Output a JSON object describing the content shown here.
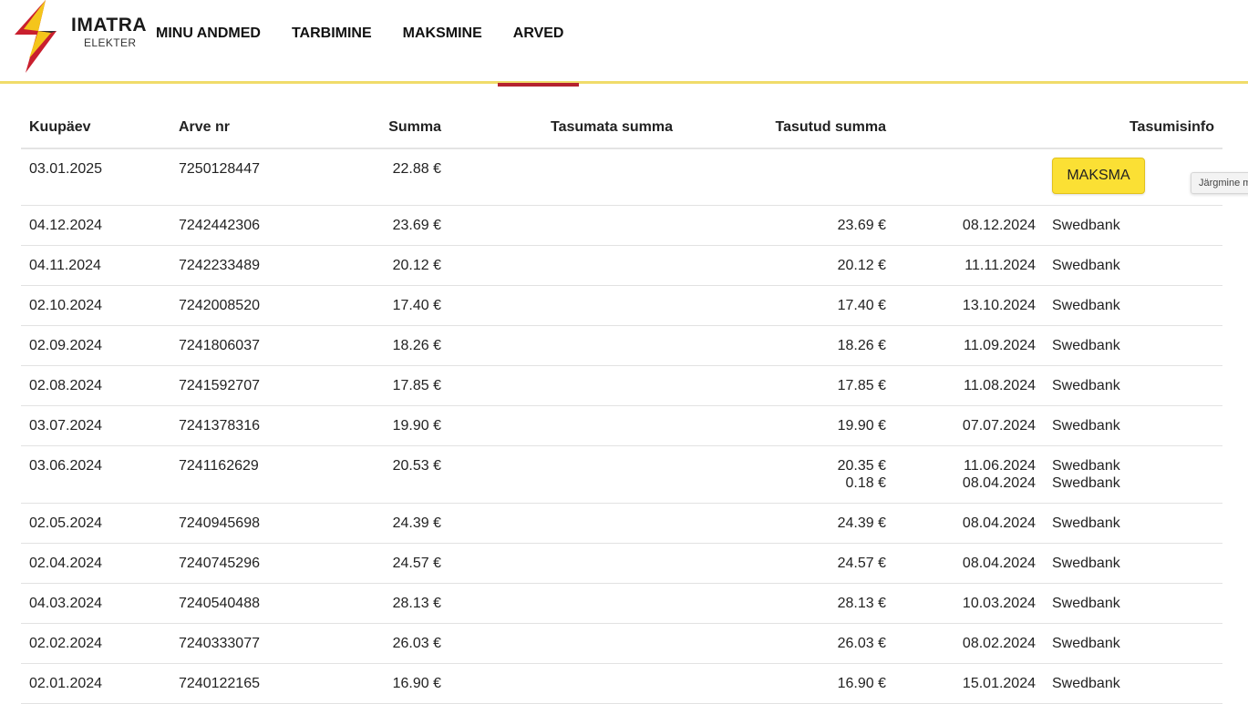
{
  "brand": {
    "name": "IMATRA",
    "sub": "ELEKTER"
  },
  "nav": [
    {
      "label": "MINU ANDMED",
      "active": false
    },
    {
      "label": "TARBIMINE",
      "active": false
    },
    {
      "label": "MAKSMINE",
      "active": false
    },
    {
      "label": "ARVED",
      "active": true
    }
  ],
  "table": {
    "headers": {
      "date": "Kuupäev",
      "invoice": "Arve nr",
      "sum": "Summa",
      "unpaid": "Tasumata summa",
      "paid": "Tasutud summa",
      "info": "Tasumisinfo"
    },
    "pay_button": "MAKSMA",
    "rows": [
      {
        "date": "03.01.2025",
        "invoice": "7250128447",
        "sum": "22.88 €",
        "unpaid": "",
        "payments": [],
        "pay": true
      },
      {
        "date": "04.12.2024",
        "invoice": "7242442306",
        "sum": "23.69 €",
        "unpaid": "",
        "payments": [
          {
            "amount": "23.69 €",
            "date": "08.12.2024",
            "bank": "Swedbank"
          }
        ]
      },
      {
        "date": "04.11.2024",
        "invoice": "7242233489",
        "sum": "20.12 €",
        "unpaid": "",
        "payments": [
          {
            "amount": "20.12 €",
            "date": "11.11.2024",
            "bank": "Swedbank"
          }
        ]
      },
      {
        "date": "02.10.2024",
        "invoice": "7242008520",
        "sum": "17.40 €",
        "unpaid": "",
        "payments": [
          {
            "amount": "17.40 €",
            "date": "13.10.2024",
            "bank": "Swedbank"
          }
        ]
      },
      {
        "date": "02.09.2024",
        "invoice": "7241806037",
        "sum": "18.26 €",
        "unpaid": "",
        "payments": [
          {
            "amount": "18.26 €",
            "date": "11.09.2024",
            "bank": "Swedbank"
          }
        ]
      },
      {
        "date": "02.08.2024",
        "invoice": "7241592707",
        "sum": "17.85 €",
        "unpaid": "",
        "payments": [
          {
            "amount": "17.85 €",
            "date": "11.08.2024",
            "bank": "Swedbank"
          }
        ]
      },
      {
        "date": "03.07.2024",
        "invoice": "7241378316",
        "sum": "19.90 €",
        "unpaid": "",
        "payments": [
          {
            "amount": "19.90 €",
            "date": "07.07.2024",
            "bank": "Swedbank"
          }
        ]
      },
      {
        "date": "03.06.2024",
        "invoice": "7241162629",
        "sum": "20.53 €",
        "unpaid": "",
        "payments": [
          {
            "amount": "20.35 €",
            "date": "11.06.2024",
            "bank": "Swedbank"
          },
          {
            "amount": "0.18 €",
            "date": "08.04.2024",
            "bank": "Swedbank"
          }
        ]
      },
      {
        "date": "02.05.2024",
        "invoice": "7240945698",
        "sum": "24.39 €",
        "unpaid": "",
        "payments": [
          {
            "amount": "24.39 €",
            "date": "08.04.2024",
            "bank": "Swedbank"
          }
        ]
      },
      {
        "date": "02.04.2024",
        "invoice": "7240745296",
        "sum": "24.57 €",
        "unpaid": "",
        "payments": [
          {
            "amount": "24.57 €",
            "date": "08.04.2024",
            "bank": "Swedbank"
          }
        ]
      },
      {
        "date": "04.03.2024",
        "invoice": "7240540488",
        "sum": "28.13 €",
        "unpaid": "",
        "payments": [
          {
            "amount": "28.13 €",
            "date": "10.03.2024",
            "bank": "Swedbank"
          }
        ]
      },
      {
        "date": "02.02.2024",
        "invoice": "7240333077",
        "sum": "26.03 €",
        "unpaid": "",
        "payments": [
          {
            "amount": "26.03 €",
            "date": "08.02.2024",
            "bank": "Swedbank"
          }
        ]
      },
      {
        "date": "02.01.2024",
        "invoice": "7240122165",
        "sum": "16.90 €",
        "unpaid": "",
        "payments": [
          {
            "amount": "16.90 €",
            "date": "15.01.2024",
            "bank": "Swedbank"
          }
        ]
      }
    ]
  },
  "tooltip": "Järgmine m",
  "colors": {
    "accent_yellow": "#fbe034",
    "active_tab": "#b5222f",
    "header_line": "#f0dc6a"
  }
}
